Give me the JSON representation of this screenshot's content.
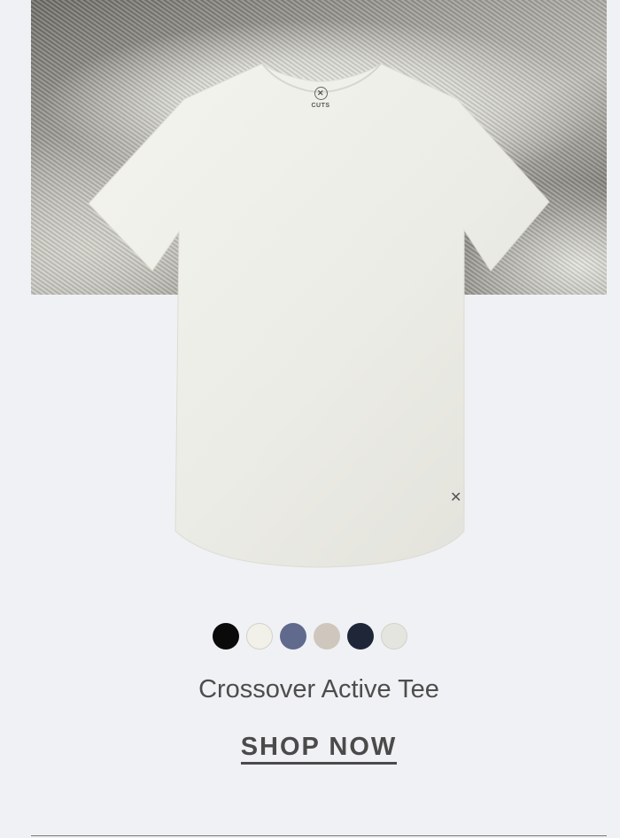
{
  "hero": {
    "image": "knit-fabric-texture"
  },
  "product": {
    "image": "white-crew-tee",
    "logo_text": "CUTS",
    "logo_mark": "✕",
    "hem_mark": "✕",
    "name": "Crossover Active Tee"
  },
  "swatches": [
    {
      "name": "black",
      "color": "#0a0a0a"
    },
    {
      "name": "off-white",
      "color": "#f1f1ea"
    },
    {
      "name": "slate-blue",
      "color": "#5f6a8c"
    },
    {
      "name": "taupe",
      "color": "#cfc6bd"
    },
    {
      "name": "navy",
      "color": "#1f2638"
    },
    {
      "name": "light-grey",
      "color": "#e5e5e0"
    }
  ],
  "cta": {
    "label": "SHOP NOW"
  }
}
